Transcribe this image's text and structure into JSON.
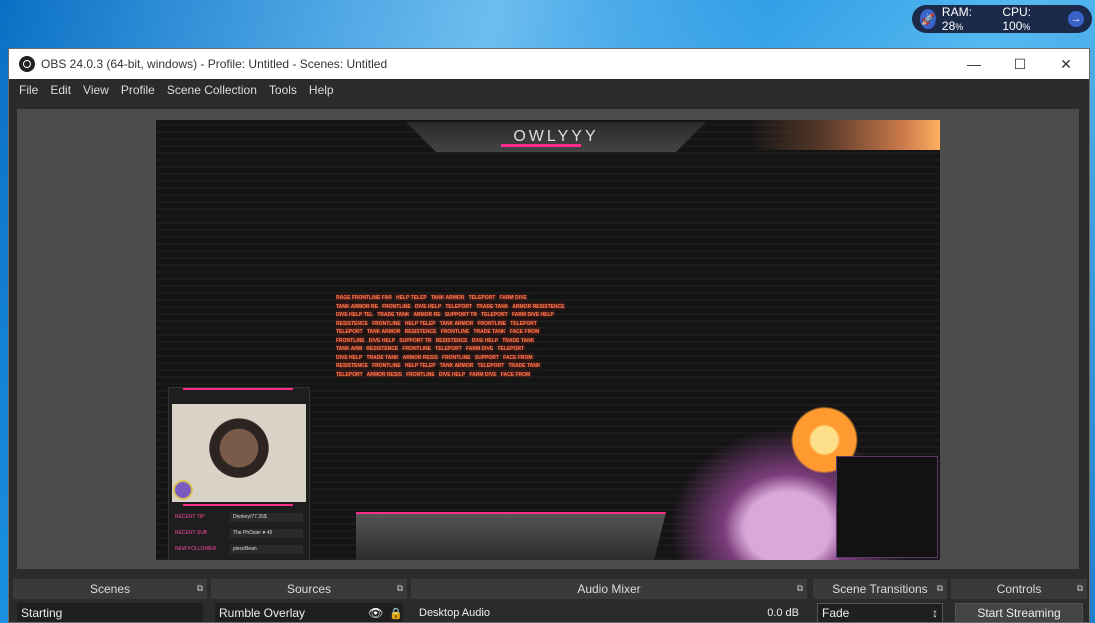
{
  "system_widget": {
    "ram_label": "RAM: 28",
    "ram_unit": "%",
    "cpu_label": "CPU: 100",
    "cpu_unit": "%"
  },
  "window": {
    "title": "OBS 24.0.3 (64-bit, windows) - Profile: Untitled - Scenes: Untitled"
  },
  "menu": [
    "File",
    "Edit",
    "View",
    "Profile",
    "Scene Collection",
    "Tools",
    "Help"
  ],
  "overlay": {
    "banner_title": "OWLYYY",
    "stats": [
      {
        "label": "RECENT TIP",
        "value": "Donkey/77.35$"
      },
      {
        "label": "RECENT SUB",
        "value": "The PhOsier ♥ 45"
      },
      {
        "label": "NEW FOLLOWER",
        "value": "pieceBean"
      }
    ]
  },
  "docks": {
    "scenes": {
      "title": "Scenes",
      "items": [
        "Starting"
      ]
    },
    "sources": {
      "title": "Sources",
      "items": [
        "Rumble Overlay"
      ]
    },
    "audio_mixer": {
      "title": "Audio Mixer",
      "tracks": [
        {
          "name": "Desktop Audio",
          "level": "0.0 dB"
        }
      ]
    },
    "scene_transitions": {
      "title": "Scene Transitions",
      "selected": "Fade"
    },
    "controls": {
      "title": "Controls",
      "start_streaming": "Start Streaming"
    }
  }
}
